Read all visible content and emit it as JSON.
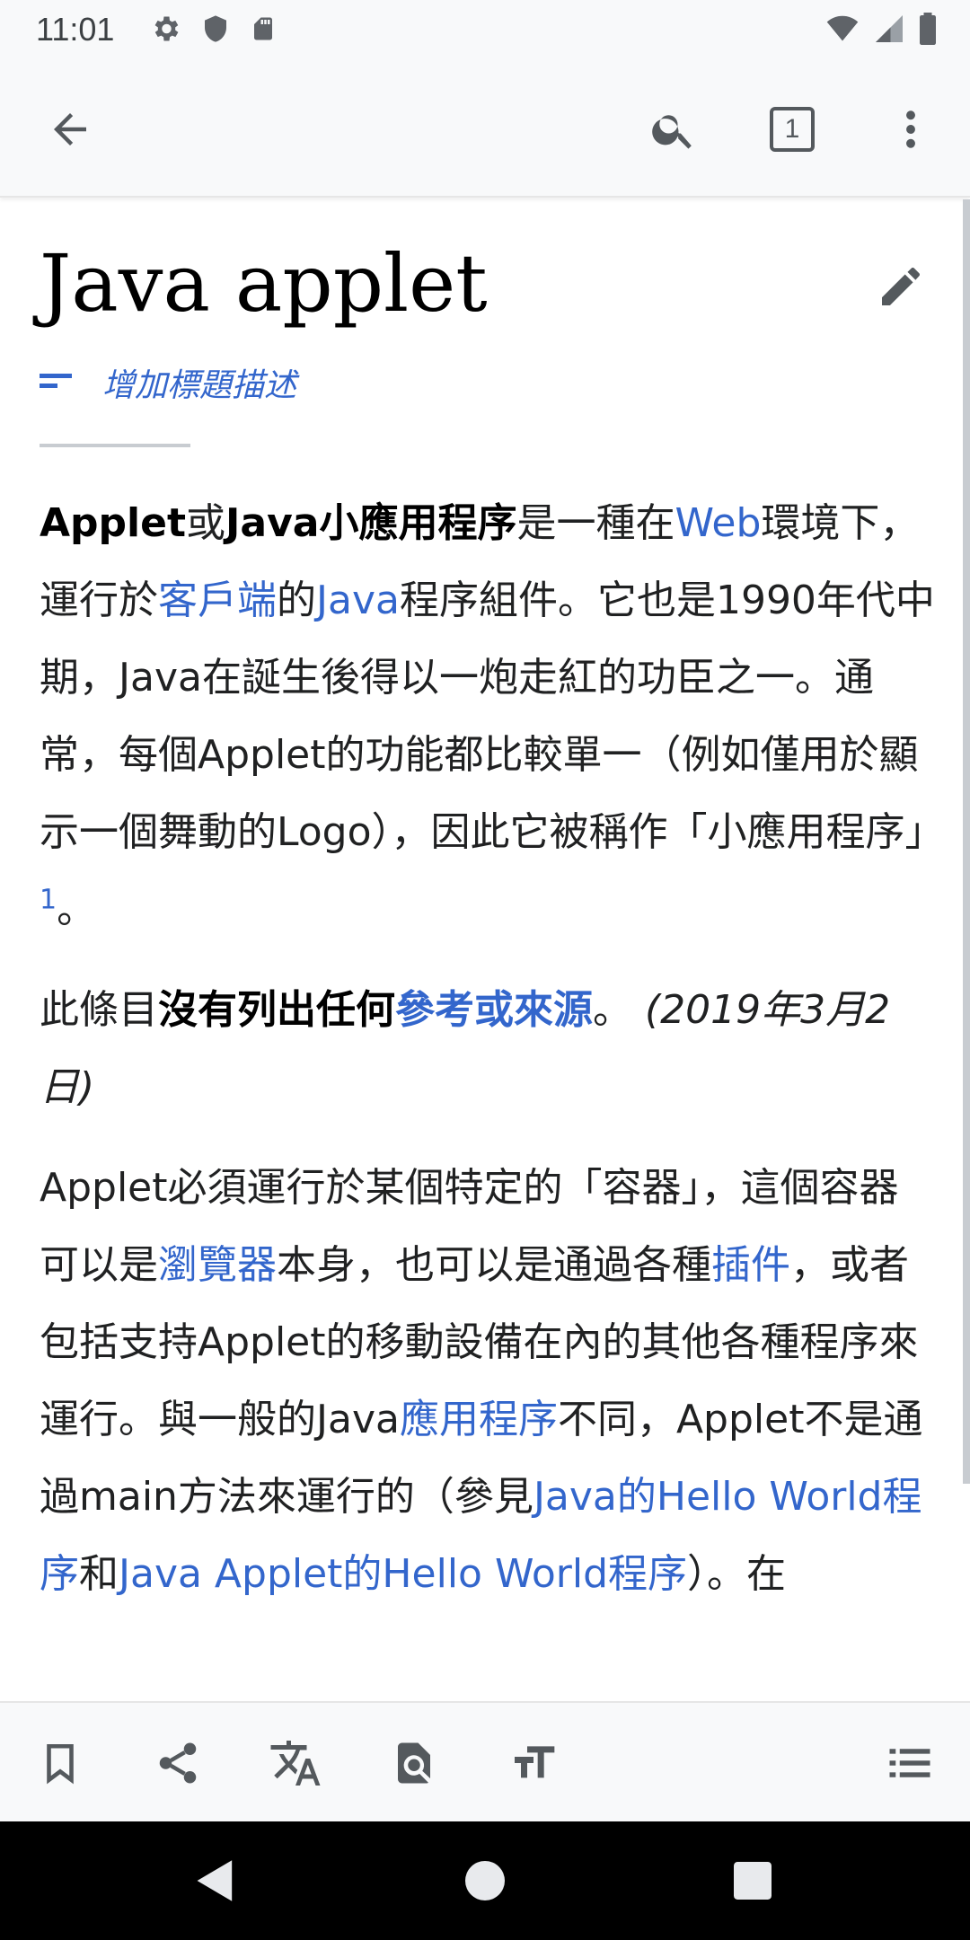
{
  "status_bar": {
    "time": "11:01",
    "icons_left": [
      "settings-icon",
      "shield-icon",
      "sd-card-icon"
    ],
    "icons_right": [
      "wifi-icon",
      "signal-icon",
      "battery-icon"
    ]
  },
  "toolbar": {
    "back": "back-arrow-icon",
    "search": "search-icon",
    "tabs_count": "1",
    "overflow": "more-vert-icon"
  },
  "article": {
    "title": "Java applet",
    "description_prompt": "增加標題描述",
    "p1": {
      "b1": "Applet",
      "t1": "或",
      "b2": "Java小應用程序",
      "t2": "是一種在",
      "l1": "Web",
      "t3": "環境下，運行於",
      "l2": "客戶端",
      "t4": "的",
      "l3": "Java",
      "t5": "程序組件。它也是1990年代中期，Java在誕生後得以一炮走紅的功臣之一。通常，每個Applet的功能都比較單一（例如僅用於顯示一個舞動的Logo），因此它被稱作「小應用程序」",
      "ref": "1",
      "t6": "。"
    },
    "p2": {
      "t1": "此條目",
      "b1": "沒有列出任何",
      "l1": "參考或來源",
      "t2": "。",
      "date": "(2019年3月2日)"
    },
    "p3": {
      "t1": "Applet必須運行於某個特定的「容器」，這個容器可以是",
      "l1": "瀏覽器",
      "t2": "本身，也可以是通過各種",
      "l2": "插件",
      "t3": "，或者包括支持Applet的移動設備在內的其他各種程序來運行。與一般的Java",
      "l3": "應用程序",
      "t4": "不同，Applet不是通過main方法來運行的（參見",
      "l4": "Java的Hello World程序",
      "t5": "和",
      "l5": "Java Applet的Hello World程序",
      "t6": "）。在"
    }
  },
  "action_bar": {
    "items": [
      "bookmark-icon",
      "share-icon",
      "translate-icon",
      "find-in-page-icon",
      "text-size-icon",
      "table-of-contents-icon"
    ]
  },
  "nav_bar": {
    "items": [
      "nav-back-icon",
      "nav-home-icon",
      "nav-recents-icon"
    ]
  },
  "colors": {
    "link": "#3366cc",
    "text": "#202122",
    "chrome": "#f8f9fa",
    "icon": "#54595d"
  }
}
